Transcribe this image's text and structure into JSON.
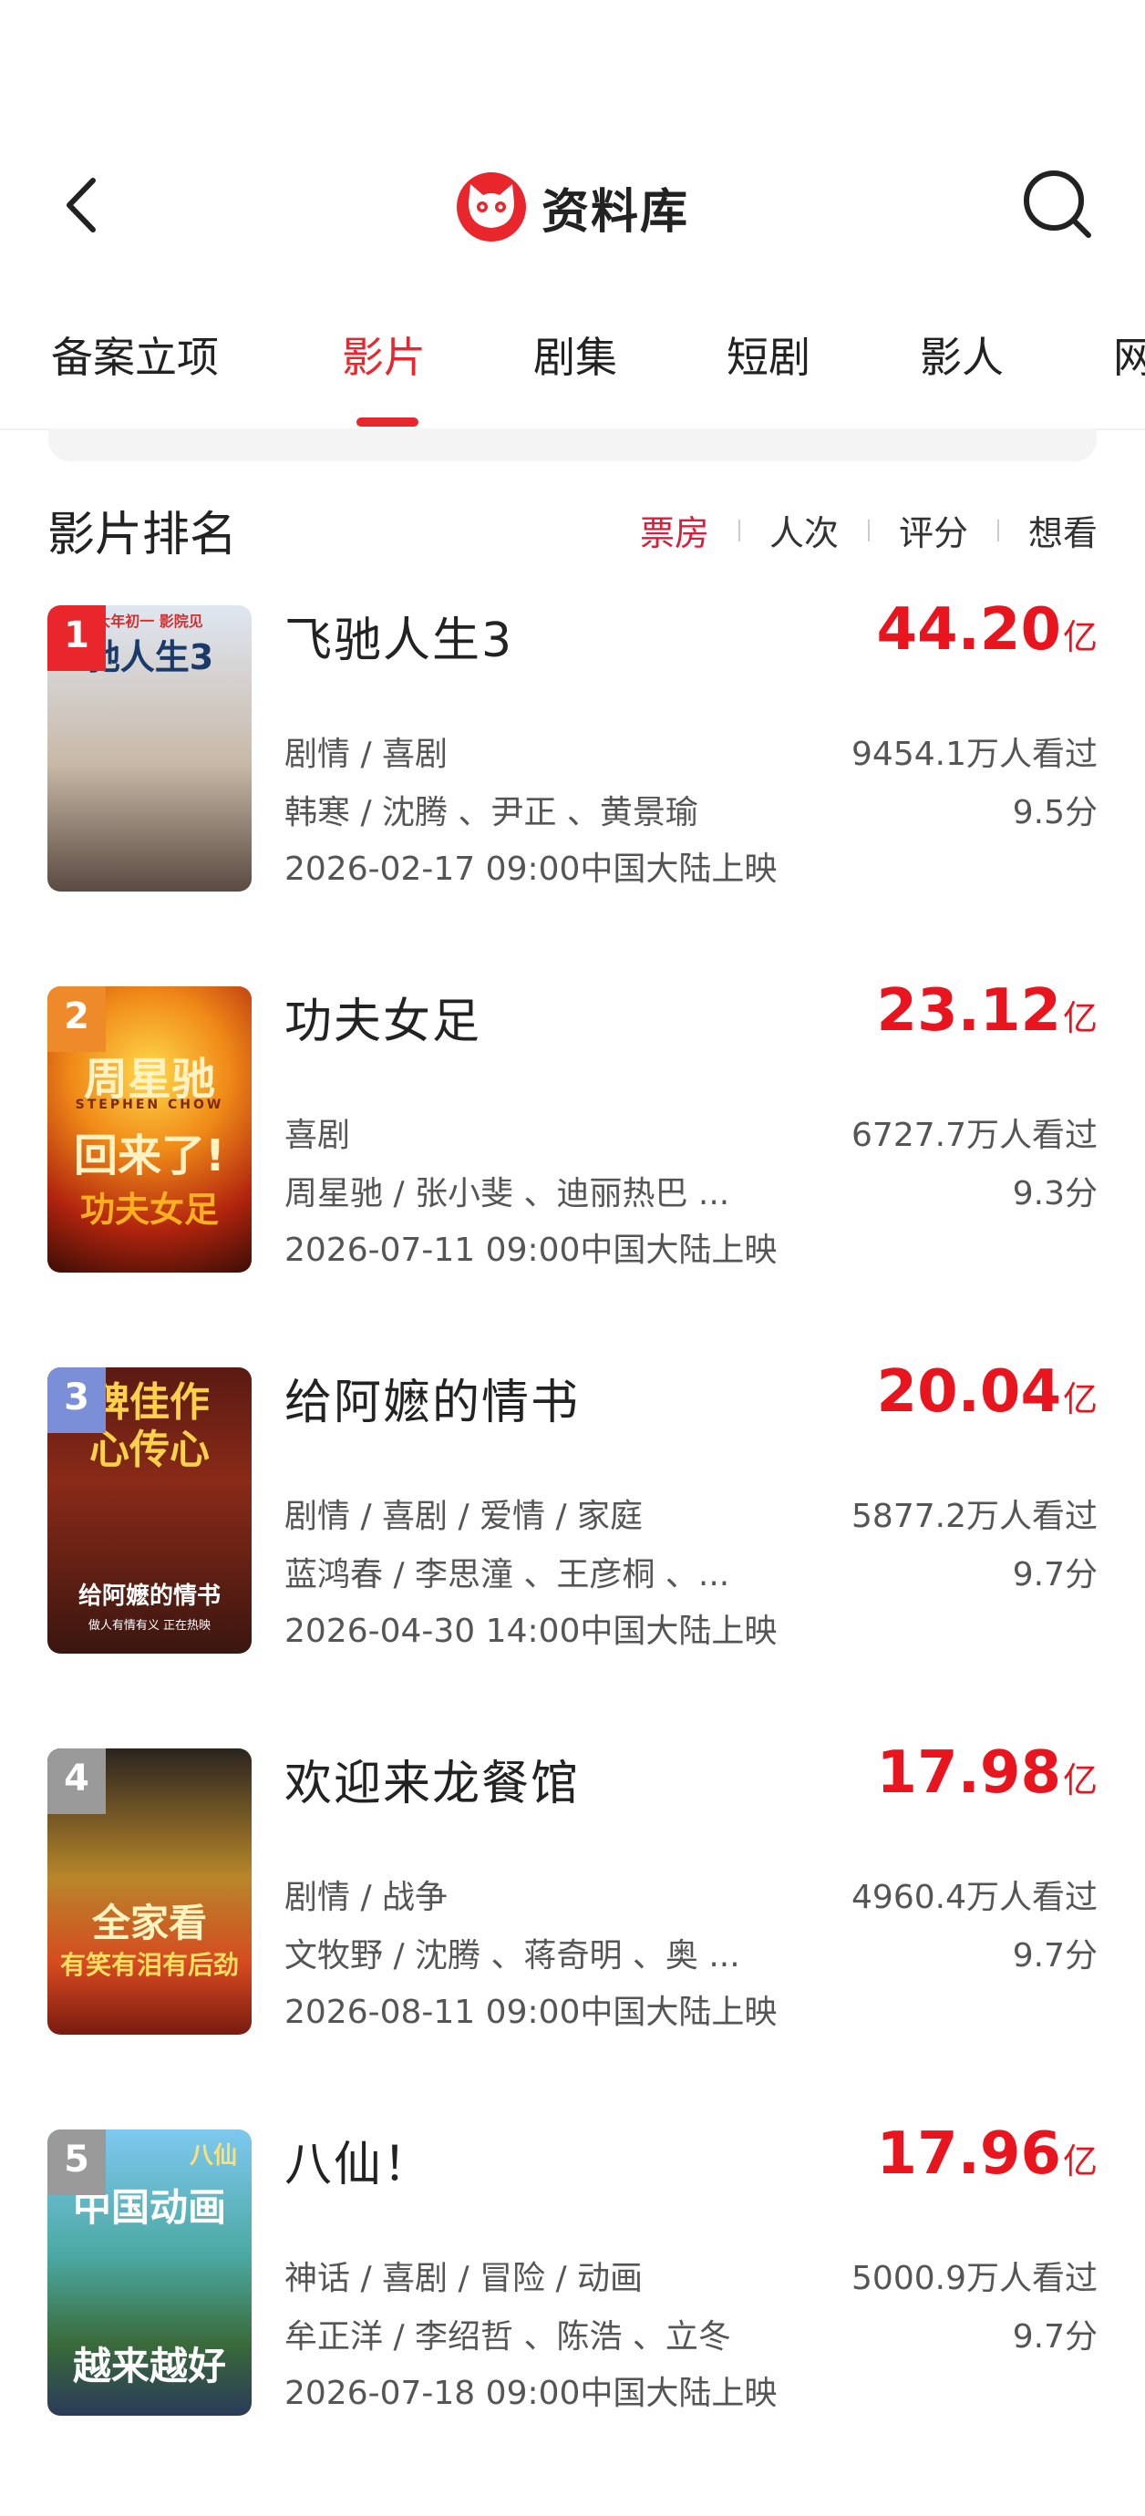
{
  "header": {
    "title": "资料库"
  },
  "tabs": [
    "备案立项",
    "影片",
    "剧集",
    "短剧",
    "影人",
    "网"
  ],
  "active_tab": 1,
  "section": {
    "title": "影片排名",
    "sort_options": [
      "票房",
      "人次",
      "评分",
      "想看"
    ]
  },
  "movies": [
    {
      "rank": "1",
      "name": "飞驰人生3",
      "box_value": "44.20",
      "box_unit": "亿",
      "genre": "剧情 / 喜剧",
      "cast": "韩寒 / 沈腾 、尹正 、黄景瑜",
      "release": "2026-02-17 09:00中国大陆上映",
      "viewers": "9454.1万人看过",
      "score": "9.5分",
      "poster_text": [
        "大年初一 影院见",
        "驰人生3"
      ]
    },
    {
      "rank": "2",
      "name": "功夫女足",
      "box_value": "23.12",
      "box_unit": "亿",
      "genre": "喜剧",
      "cast": "周星驰 / 张小斐 、迪丽热巴 ...",
      "release": "2026-07-11 09:00中国大陆上映",
      "viewers": "6727.7万人看过",
      "score": "9.3分",
      "poster_text": [
        "周星驰",
        "STEPHEN CHOW",
        "回来了!",
        "功夫女足"
      ]
    },
    {
      "rank": "3",
      "name": "给阿嬷的情书",
      "box_value": "20.04",
      "box_unit": "亿",
      "genre": "剧情 / 喜剧 / 爱情 / 家庭",
      "cast": "蓝鸿春 / 李思潼 、王彦桐 、...",
      "release": "2026-04-30 14:00中国大陆上映",
      "viewers": "5877.2万人看过",
      "score": "9.7分",
      "poster_text": [
        "碑佳作",
        "心传心",
        "给阿嬷的情书",
        "做人有情有义 正在热映"
      ]
    },
    {
      "rank": "4",
      "name": "欢迎来龙餐馆",
      "box_value": "17.98",
      "box_unit": "亿",
      "genre": "剧情 / 战争",
      "cast": "文牧野 / 沈腾 、蒋奇明 、奥 ...",
      "release": "2026-08-11 09:00中国大陆上映",
      "viewers": "4960.4万人看过",
      "score": "9.7分",
      "poster_text": [
        "全家看",
        "有笑有泪有后劲"
      ]
    },
    {
      "rank": "5",
      "name": "八仙！",
      "box_value": "17.96",
      "box_unit": "亿",
      "genre": "神话 / 喜剧 / 冒险 / 动画",
      "cast": "牟正洋 / 李绍哲 、陈浩 、立冬",
      "release": "2026-07-18 09:00中国大陆上映",
      "viewers": "5000.9万人看过",
      "score": "9.7分",
      "poster_text": [
        "八仙",
        "中国动画",
        "越来越好"
      ]
    }
  ],
  "colors": {
    "accent": "#e8262c",
    "box_office": "#e8151f"
  },
  "icons": [
    "back-arrow-icon",
    "cat-eye-logo-icon",
    "search-icon"
  ]
}
